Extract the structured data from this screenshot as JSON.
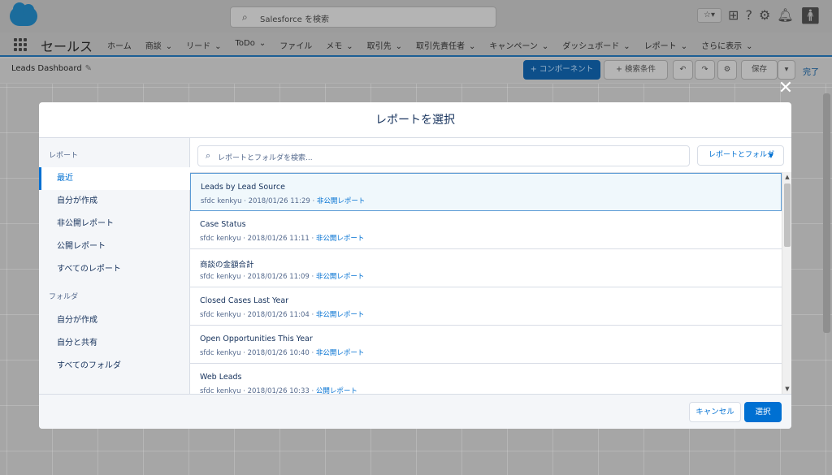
{
  "header": {
    "search_placeholder": "Salesforce を検索",
    "icons": [
      "star-icon",
      "chevron-down-icon",
      "add-icon",
      "help-icon",
      "gear-icon",
      "bell-icon",
      "avatar-icon"
    ]
  },
  "nav": {
    "app_name": "セールス",
    "items": [
      {
        "label": "ホーム",
        "has_menu": false
      },
      {
        "label": "商談",
        "has_menu": true
      },
      {
        "label": "リード",
        "has_menu": true
      },
      {
        "label": "ToDo",
        "has_menu": true
      },
      {
        "label": "ファイル",
        "has_menu": false
      },
      {
        "label": "メモ",
        "has_menu": true
      },
      {
        "label": "取引先",
        "has_menu": true
      },
      {
        "label": "取引先責任者",
        "has_menu": true
      },
      {
        "label": "キャンペーン",
        "has_menu": true
      },
      {
        "label": "ダッシュボード",
        "has_menu": true
      },
      {
        "label": "レポート",
        "has_menu": true
      },
      {
        "label": "さらに表示",
        "has_menu": true
      }
    ]
  },
  "subheader": {
    "title": "Leads Dashboard",
    "add_component": "+ コンポーネント",
    "filter": "+ 検索条件",
    "save": "保存",
    "done": "完了"
  },
  "modal": {
    "title": "レポートを選択",
    "close_label": "✕",
    "sidebar": {
      "reports_section": "レポート",
      "report_items": [
        "最近",
        "自分が作成",
        "非公開レポート",
        "公開レポート",
        "すべてのレポート"
      ],
      "active_item": "最近",
      "folders_section": "フォルダ",
      "folder_items": [
        "自分が作成",
        "自分と共有",
        "すべてのフォルダ"
      ]
    },
    "search_placeholder": "レポートとフォルダを検索...",
    "filter_button": "レポートとフォルダ",
    "reports": [
      {
        "name": "Leads by Lead Source",
        "owner": "sfdc kenkyu",
        "date": "2018/01/26 11:29",
        "visibility": "非公開レポート",
        "selected": true
      },
      {
        "name": "Case Status",
        "owner": "sfdc kenkyu",
        "date": "2018/01/26 11:11",
        "visibility": "非公開レポート",
        "selected": false
      },
      {
        "name": "商談の金額合計",
        "owner": "sfdc kenkyu",
        "date": "2018/01/26 11:09",
        "visibility": "非公開レポート",
        "selected": false
      },
      {
        "name": "Closed Cases Last Year",
        "owner": "sfdc kenkyu",
        "date": "2018/01/26 11:04",
        "visibility": "非公開レポート",
        "selected": false
      },
      {
        "name": "Open Opportunities This Year",
        "owner": "sfdc kenkyu",
        "date": "2018/01/26 10:40",
        "visibility": "非公開レポート",
        "selected": false
      },
      {
        "name": "Web Leads",
        "owner": "sfdc kenkyu",
        "date": "2018/01/26 10:33",
        "visibility": "公開レポート",
        "selected": false
      }
    ],
    "cancel": "キャンセル",
    "select": "選択"
  }
}
